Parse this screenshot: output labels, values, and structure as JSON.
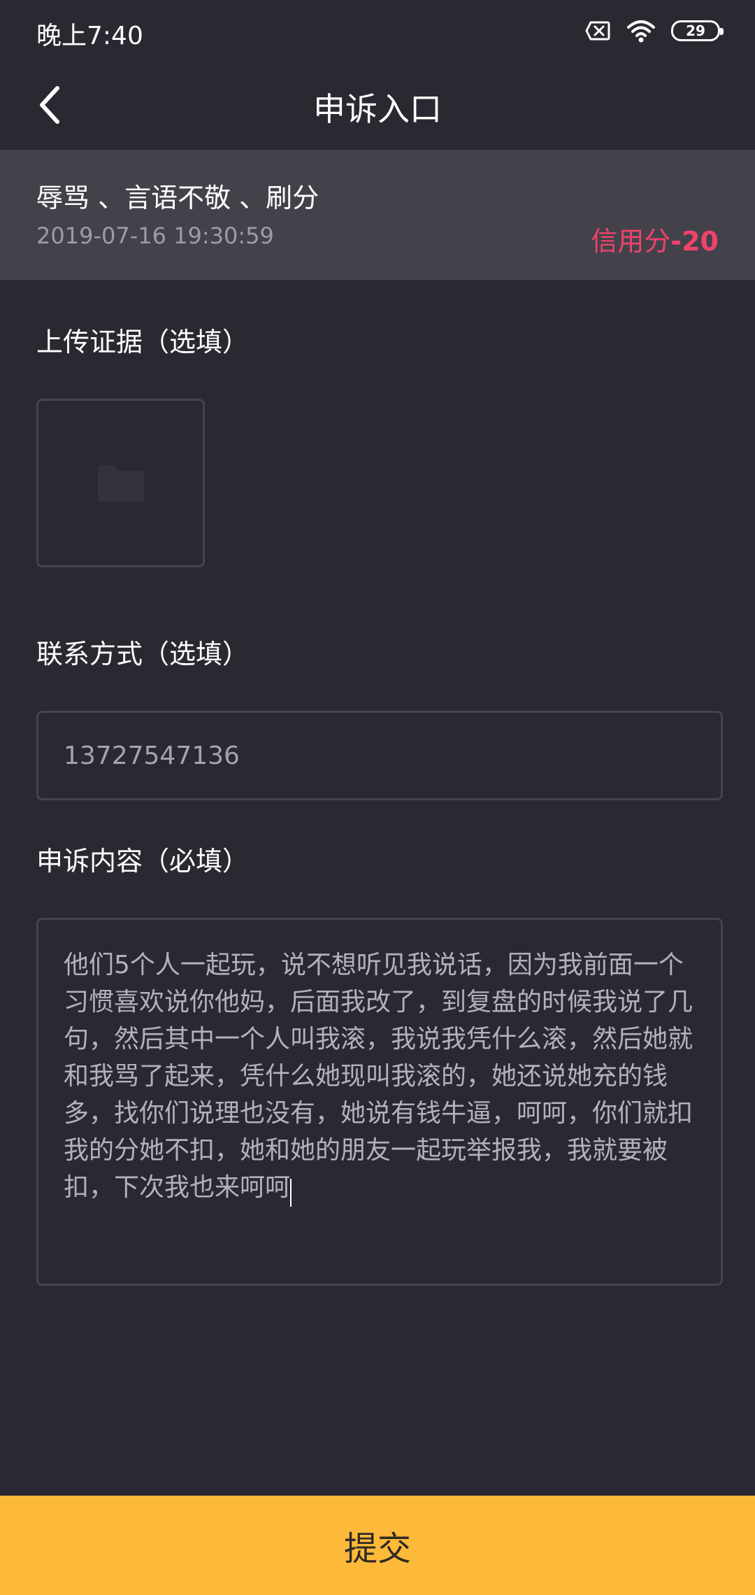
{
  "status_bar": {
    "time": "晚上7:40",
    "battery_level": "29",
    "icons": [
      "sim-off-icon",
      "wifi-icon",
      "battery-icon"
    ]
  },
  "header": {
    "title": "申诉入口",
    "back_icon": "chevron-left-icon"
  },
  "violation": {
    "reason": "辱骂 、言语不敬 、刷分",
    "timestamp": "2019-07-16 19:30:59",
    "credit_label": "信用分",
    "credit_value": "-20"
  },
  "evidence": {
    "label": "上传证据（选填）",
    "upload_icon": "folder-icon"
  },
  "contact": {
    "label": "联系方式（选填）",
    "value": "13727547136"
  },
  "appeal": {
    "label": "申诉内容（必填）",
    "content": "他们5个人一起玩，说不想听见我说话，因为我前面一个习惯喜欢说你他妈，后面我改了，到复盘的时候我说了几句，然后其中一个人叫我滚，我说我凭什么滚，然后她就和我骂了起来，凭什么她现叫我滚的，她还说她充的钱多，找你们说理也没有，她说有钱牛逼，呵呵，你们就扣我的分她不扣，她和她的朋友一起玩举报我，我就要被扣，下次我也来呵呵"
  },
  "submit": {
    "label": "提交"
  },
  "colors": {
    "background": "#2a2932",
    "card": "#43424b",
    "accent_red": "#f0436a",
    "button_yellow": "#fdb93a"
  }
}
